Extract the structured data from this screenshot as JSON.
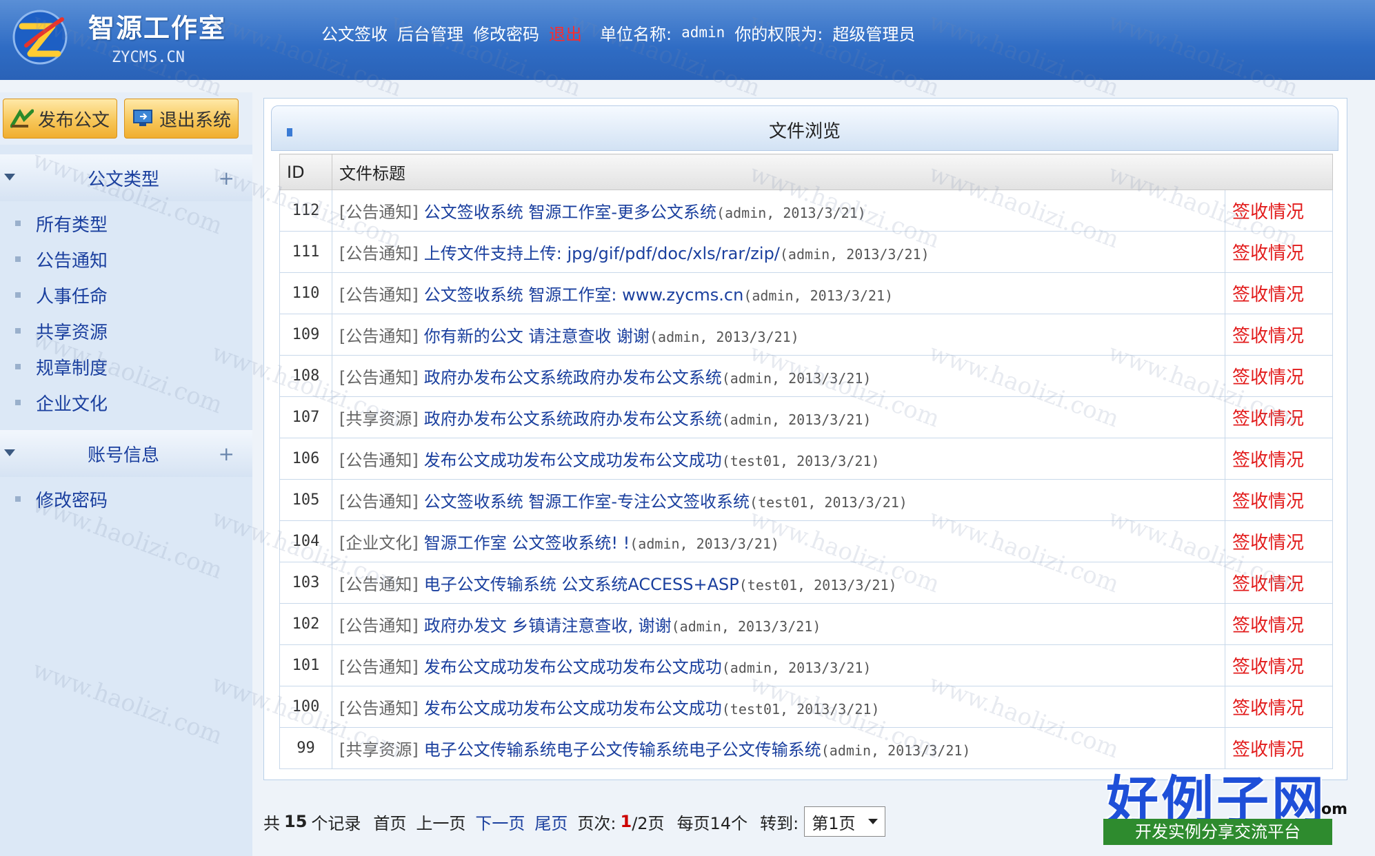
{
  "header": {
    "logo_cn": "智源工作室",
    "logo_en": "ZYCMS.CN",
    "nav": {
      "sign": "公文签收",
      "admin": "后台管理",
      "change_pwd": "修改密码",
      "logout": "退出",
      "unit_label": "单位名称:",
      "user": "admin",
      "role_label": "你的权限为:",
      "role": "超级管理员"
    }
  },
  "sidebar": {
    "publish_button": "发布公文",
    "exit_button": "退出系统",
    "sections": [
      {
        "title": "公文类型",
        "items": [
          "所有类型",
          "公告通知",
          "人事任命",
          "共享资源",
          "规章制度",
          "企业文化"
        ]
      },
      {
        "title": "账号信息",
        "items": [
          "修改密码"
        ]
      }
    ],
    "plus": "+"
  },
  "main": {
    "panel_title": "文件浏览",
    "columns": {
      "id": "ID",
      "title": "文件标题"
    },
    "action_label": "签收情况",
    "rows": [
      {
        "id": "112",
        "tag": "[公告通知]",
        "title": "公文签收系统 智源工作室-更多公文系统",
        "meta": "(admin, 2013/3/21)"
      },
      {
        "id": "111",
        "tag": "[公告通知]",
        "title": "上传文件支持上传: jpg/gif/pdf/doc/xls/rar/zip/",
        "meta": "(admin, 2013/3/21)"
      },
      {
        "id": "110",
        "tag": "[公告通知]",
        "title": "公文签收系统 智源工作室: www.zycms.cn",
        "meta": "(admin, 2013/3/21)"
      },
      {
        "id": "109",
        "tag": "[公告通知]",
        "title": "你有新的公文 请注意查收 谢谢",
        "meta": "(admin, 2013/3/21)"
      },
      {
        "id": "108",
        "tag": "[公告通知]",
        "title": "政府办发布公文系统政府办发布公文系统",
        "meta": "(admin, 2013/3/21)"
      },
      {
        "id": "107",
        "tag": "[共享资源]",
        "title": "政府办发布公文系统政府办发布公文系统",
        "meta": "(admin, 2013/3/21)"
      },
      {
        "id": "106",
        "tag": "[公告通知]",
        "title": "发布公文成功发布公文成功发布公文成功",
        "meta": "(test01, 2013/3/21)"
      },
      {
        "id": "105",
        "tag": "[公告通知]",
        "title": "公文签收系统 智源工作室-专注公文签收系统",
        "meta": "(test01, 2013/3/21)"
      },
      {
        "id": "104",
        "tag": "[企业文化]",
        "title": "智源工作室 公文签收系统! !",
        "meta": "(admin, 2013/3/21)"
      },
      {
        "id": "103",
        "tag": "[公告通知]",
        "title": "电子公文传输系统 公文系统ACCESS+ASP",
        "meta": "(test01, 2013/3/21)"
      },
      {
        "id": "102",
        "tag": "[公告通知]",
        "title": "政府办发文 乡镇请注意查收, 谢谢",
        "meta": "(admin, 2013/3/21)"
      },
      {
        "id": "101",
        "tag": "[公告通知]",
        "title": "发布公文成功发布公文成功发布公文成功",
        "meta": "(admin, 2013/3/21)"
      },
      {
        "id": "100",
        "tag": "[公告通知]",
        "title": "发布公文成功发布公文成功发布公文成功",
        "meta": "(test01, 2013/3/21)"
      },
      {
        "id": "99",
        "tag": "[共享资源]",
        "title": "电子公文传输系统电子公文传输系统电子公文传输系统",
        "meta": "(admin, 2013/3/21)"
      }
    ]
  },
  "pager": {
    "total_prefix": "共",
    "total": "15",
    "total_suffix": "个记录",
    "first": "首页",
    "prev": "上一页",
    "next": "下一页",
    "last": "尾页",
    "page_label": "页次:",
    "current": "1",
    "pages": "/2页",
    "per_page": "每页14个",
    "goto": "转到:",
    "select_value": "第1页"
  },
  "watermark": {
    "site": "www.haolizi.com",
    "brand": "好例子网",
    "slogan": "开发实例分享交流平台",
    "badge": "om"
  }
}
